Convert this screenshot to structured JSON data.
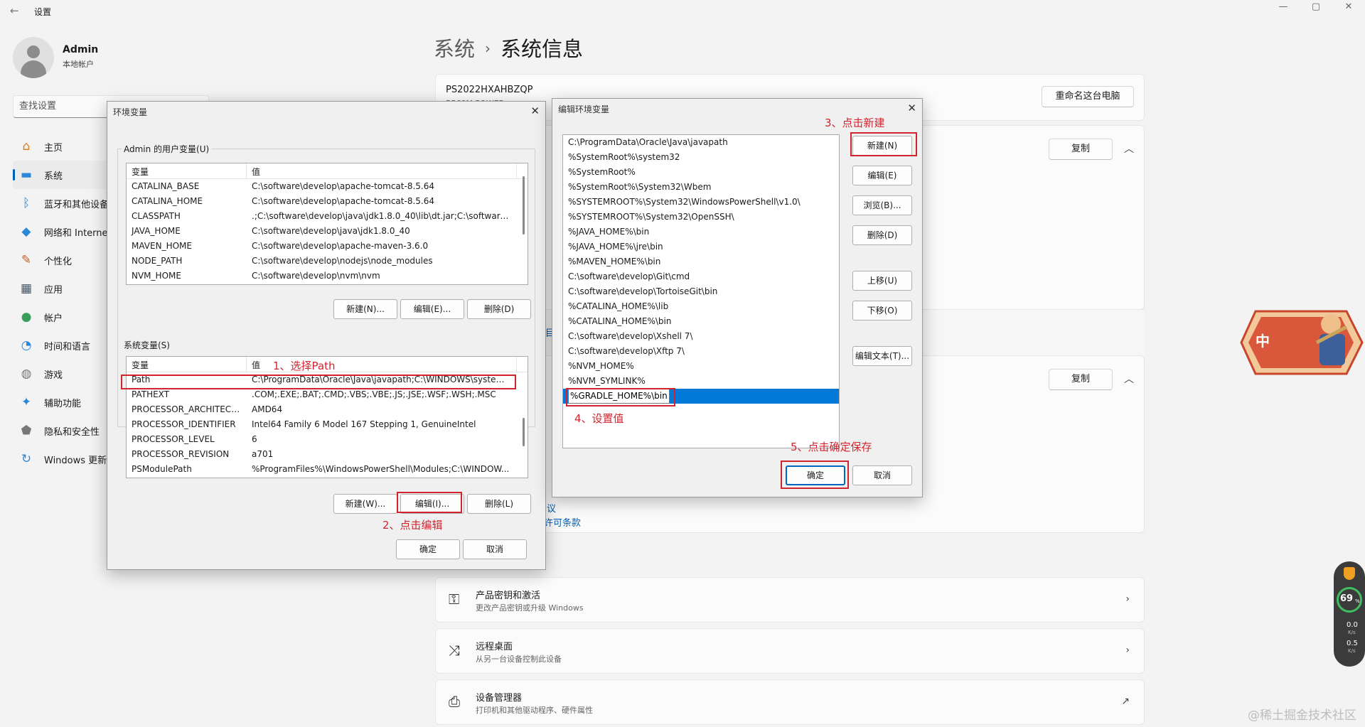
{
  "window": {
    "title": "设置",
    "back_glyph": "←",
    "min_glyph": "—",
    "max_glyph": "▢",
    "close_glyph": "✕"
  },
  "profile": {
    "name": "Admin",
    "subtitle": "本地帐户"
  },
  "search": {
    "placeholder": "查找设置"
  },
  "nav": [
    {
      "label": "主页",
      "icon": "home-icon",
      "glyph": "⌂",
      "color": "#e07a1f"
    },
    {
      "label": "系统",
      "icon": "system-icon",
      "glyph": "▬",
      "color": "#2b88d8"
    },
    {
      "label": "蓝牙和其他设备",
      "icon": "bluetooth-icon",
      "glyph": "ᛒ",
      "color": "#2b88d8"
    },
    {
      "label": "网络和 Internet",
      "icon": "wifi-icon",
      "glyph": "◆",
      "color": "#2b88d8"
    },
    {
      "label": "个性化",
      "icon": "brush-icon",
      "glyph": "✎",
      "color": "#c2602b"
    },
    {
      "label": "应用",
      "icon": "apps-icon",
      "glyph": "▦",
      "color": "#445566"
    },
    {
      "label": "帐户",
      "icon": "account-icon",
      "glyph": "●",
      "color": "#3a9f5c"
    },
    {
      "label": "时间和语言",
      "icon": "clock-globe-icon",
      "glyph": "◔",
      "color": "#2b88d8"
    },
    {
      "label": "游戏",
      "icon": "gamepad-icon",
      "glyph": "◍",
      "color": "#777777"
    },
    {
      "label": "辅助功能",
      "icon": "accessibility-icon",
      "glyph": "✦",
      "color": "#2b88d8"
    },
    {
      "label": "隐私和安全性",
      "icon": "shield-icon",
      "glyph": "⬟",
      "color": "#777777"
    },
    {
      "label": "Windows 更新",
      "icon": "update-icon",
      "glyph": "↻",
      "color": "#2b88d8"
    }
  ],
  "breadcrumb": {
    "parent": "系统",
    "separator": "›",
    "current": "系统信息"
  },
  "device": {
    "name": "PS2022HXAHBZQP",
    "model_partial": "B560M POWER"
  },
  "buttons": {
    "rename": "重命名这台电脑",
    "copy": "复制",
    "copy2": "复制"
  },
  "links": {
    "link1_partial": "议",
    "link2_partial": "许可条款",
    "link3_partial": "目"
  },
  "list_cards": [
    {
      "icon": "key-icon",
      "glyph": "⚿",
      "title": "产品密钥和激活",
      "subtitle": "更改产品密钥或升级 Windows",
      "arrow": "›"
    },
    {
      "icon": "remote-desktop-icon",
      "glyph": "⤨",
      "title": "远程桌面",
      "subtitle": "从另一台设备控制此设备",
      "arrow": "›"
    },
    {
      "icon": "device-manager-icon",
      "glyph": "⎙",
      "title": "设备管理器",
      "subtitle": "打印机和其他驱动程序、硬件属性",
      "arrow": "↗"
    }
  ],
  "env_dialog": {
    "title": "环境变量",
    "close_glyph": "✕",
    "user_group": "Admin 的用户变量(U)",
    "col_var": "变量",
    "col_val": "值",
    "user_vars": [
      {
        "name": "CATALINA_BASE",
        "value": "C:\\software\\develop\\apache-tomcat-8.5.64"
      },
      {
        "name": "CATALINA_HOME",
        "value": "C:\\software\\develop\\apache-tomcat-8.5.64"
      },
      {
        "name": "CLASSPATH",
        "value": ".;C:\\software\\develop\\java\\jdk1.8.0_40\\lib\\dt.jar;C:\\software\\d..."
      },
      {
        "name": "JAVA_HOME",
        "value": "C:\\software\\develop\\java\\jdk1.8.0_40"
      },
      {
        "name": "MAVEN_HOME",
        "value": "C:\\software\\develop\\apache-maven-3.6.0"
      },
      {
        "name": "NODE_PATH",
        "value": "C:\\software\\develop\\nodejs\\node_modules"
      },
      {
        "name": "NVM_HOME",
        "value": "C:\\software\\develop\\nvm\\nvm"
      }
    ],
    "user_new": "新建(N)...",
    "user_edit": "编辑(E)...",
    "user_delete": "删除(D)",
    "sys_group": "系统变量(S)",
    "sys_vars": [
      {
        "name": "Path",
        "value": "C:\\ProgramData\\Oracle\\Java\\javapath;C:\\WINDOWS\\system3..."
      },
      {
        "name": "PATHEXT",
        "value": ".COM;.EXE;.BAT;.CMD;.VBS;.VBE;.JS;.JSE;.WSF;.WSH;.MSC"
      },
      {
        "name": "PROCESSOR_ARCHITECT...",
        "value": "AMD64"
      },
      {
        "name": "PROCESSOR_IDENTIFIER",
        "value": "Intel64 Family 6 Model 167 Stepping 1, GenuineIntel"
      },
      {
        "name": "PROCESSOR_LEVEL",
        "value": "6"
      },
      {
        "name": "PROCESSOR_REVISION",
        "value": "a701"
      },
      {
        "name": "PSModulePath",
        "value": "%ProgramFiles%\\WindowsPowerShell\\Modules;C:\\WINDOW..."
      }
    ],
    "sys_new": "新建(W)...",
    "sys_edit": "编辑(I)...",
    "sys_delete": "删除(L)",
    "ok": "确定",
    "cancel": "取消"
  },
  "edit_dialog": {
    "title": "编辑环境变量",
    "close_glyph": "✕",
    "paths": [
      "C:\\ProgramData\\Oracle\\Java\\javapath",
      "%SystemRoot%\\system32",
      "%SystemRoot%",
      "%SystemRoot%\\System32\\Wbem",
      "%SYSTEMROOT%\\System32\\WindowsPowerShell\\v1.0\\",
      "%SYSTEMROOT%\\System32\\OpenSSH\\",
      "%JAVA_HOME%\\bin",
      "%JAVA_HOME%\\jre\\bin",
      "%MAVEN_HOME%\\bin",
      "C:\\software\\develop\\Git\\cmd",
      "C:\\software\\develop\\TortoiseGit\\bin",
      "%CATALINA_HOME%\\lib",
      "%CATALINA_HOME%\\bin",
      "C:\\software\\develop\\Xshell 7\\",
      "C:\\software\\develop\\Xftp 7\\",
      "%NVM_HOME%",
      "%NVM_SYMLINK%"
    ],
    "editing_value": "%GRADLE_HOME%\\bin",
    "btn_new": "新建(N)",
    "btn_edit": "编辑(E)",
    "btn_browse": "浏览(B)...",
    "btn_delete": "删除(D)",
    "btn_up": "上移(U)",
    "btn_down": "下移(O)",
    "btn_edit_text": "编辑文本(T)...",
    "ok": "确定",
    "cancel": "取消"
  },
  "annotations": {
    "step1": "1、选择Path",
    "step2": "2、点击编辑",
    "step3": "3、点击新建",
    "step4": "4、设置值",
    "step5": "5、点击确定保存",
    "color": "#d1242f"
  },
  "mascot": {
    "badge_text": "中"
  },
  "monitor": {
    "percent": "69",
    "percent_unit": "%",
    "up": "0.0",
    "down": "0.5",
    "unit": "K/s"
  },
  "watermark": "@稀土掘金技术社区"
}
